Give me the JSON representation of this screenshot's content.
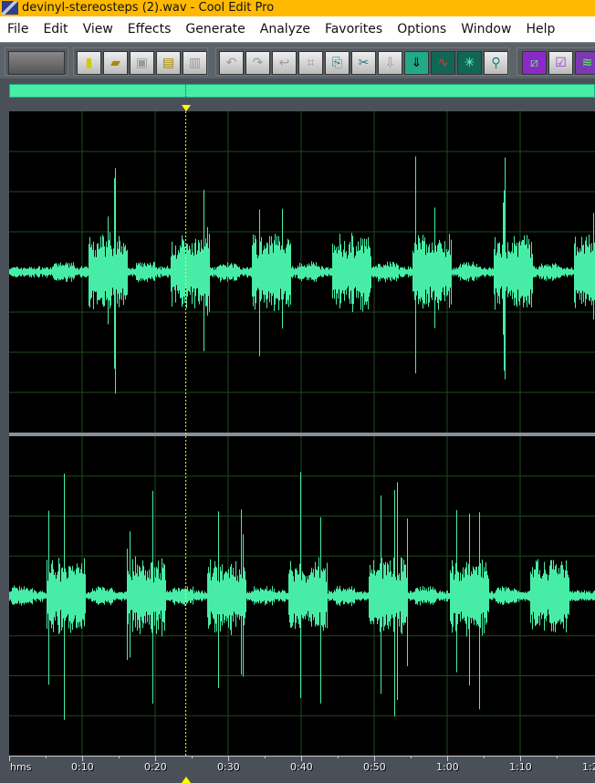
{
  "window": {
    "title": "devinyl-stereosteps (2).wav - Cool Edit Pro"
  },
  "menu": [
    "File",
    "Edit",
    "View",
    "Effects",
    "Generate",
    "Analyze",
    "Favorites",
    "Options",
    "Window",
    "Help"
  ],
  "toolbar": {
    "buttons": [
      "mode-switch",
      "new",
      "open",
      "save",
      "save-as",
      "save-all",
      "undo",
      "redo",
      "repeat",
      "crop",
      "copy",
      "cut",
      "paste",
      "mix-paste",
      "spectral-view",
      "noise-reduction",
      "zoom-to-selection",
      "multitrack",
      "properties",
      "amplify"
    ]
  },
  "ruler": {
    "unit_label": "hms",
    "labels": [
      "0:10",
      "0:20",
      "0:30",
      "0:40",
      "0:50",
      "1:00",
      "1:10",
      "1:2"
    ]
  },
  "colors": {
    "waveform": "#47eda6",
    "background": "#000000",
    "grid": "#1e4a1e",
    "cursor": "#ffff00",
    "title_bar": "#ffb900"
  },
  "cursor_time_seconds": 24.2
}
